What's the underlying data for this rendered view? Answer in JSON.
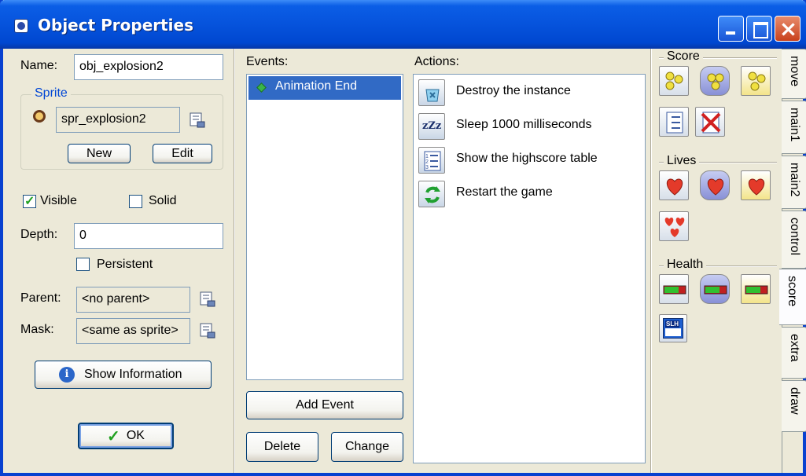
{
  "window": {
    "title": "Object Properties"
  },
  "props": {
    "name_label": "Name:",
    "name_value": "obj_explosion2",
    "sprite_group": "Sprite",
    "sprite_value": "spr_explosion2",
    "new_btn": "New",
    "edit_btn": "Edit",
    "visible_label": "Visible",
    "visible_checked": true,
    "solid_label": "Solid",
    "solid_checked": false,
    "depth_label": "Depth:",
    "depth_value": "0",
    "persistent_label": "Persistent",
    "persistent_checked": false,
    "parent_label": "Parent:",
    "parent_value": "<no parent>",
    "mask_label": "Mask:",
    "mask_value": "<same as sprite>",
    "show_info_btn": "Show Information",
    "ok_btn": "OK"
  },
  "events": {
    "header": "Events:",
    "items": [
      "Animation End"
    ],
    "add_btn": "Add Event",
    "delete_btn": "Delete",
    "change_btn": "Change"
  },
  "actions": {
    "header": "Actions:",
    "items": [
      {
        "icon": "destroy-instance-icon",
        "label": "Destroy the instance"
      },
      {
        "icon": "sleep-icon",
        "label": "Sleep 1000 milliseconds"
      },
      {
        "icon": "highscore-table-icon",
        "label": "Show the highscore table"
      },
      {
        "icon": "restart-game-icon",
        "label": "Restart the game"
      }
    ]
  },
  "palette": {
    "score_label": "Score",
    "lives_label": "Lives",
    "health_label": "Health",
    "sleep_glyph": "zZz",
    "score_bar_text": "SLH"
  },
  "tabs": [
    "move",
    "main1",
    "main2",
    "control",
    "score",
    "extra",
    "draw"
  ],
  "active_tab": "score"
}
